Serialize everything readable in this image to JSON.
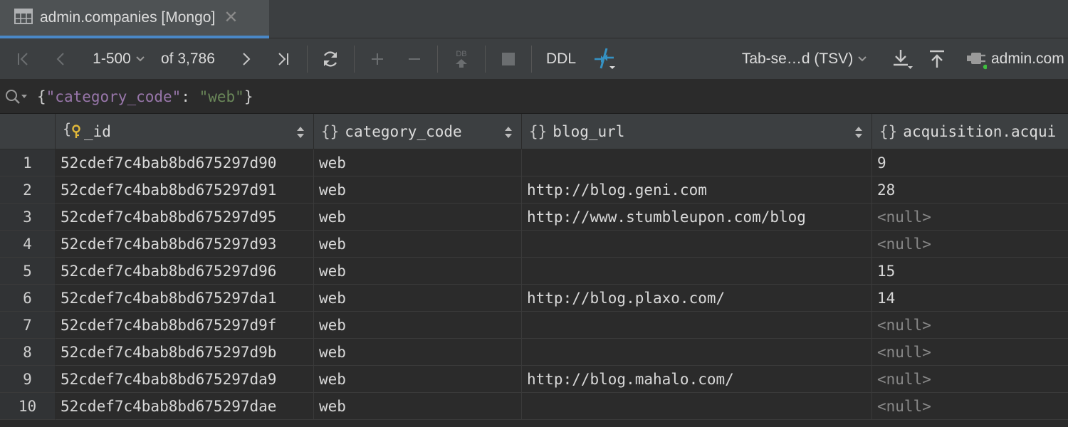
{
  "tab": {
    "title": "admin.companies [Mongo]",
    "close": "✕"
  },
  "toolbar": {
    "page_range": "1-500",
    "total": "of 3,786",
    "ddl": "DDL",
    "db_label": "DB",
    "format": "Tab-se…d (TSV)",
    "connection": "admin.com"
  },
  "filter": {
    "open": "{",
    "key": "\"category_code\"",
    "colon": ": ",
    "value": "\"web\"",
    "close": "}"
  },
  "columns": [
    {
      "name": "_id",
      "type_icon": "key-object-icon"
    },
    {
      "name": "category_code",
      "type_icon": "object-icon"
    },
    {
      "name": "blog_url",
      "type_icon": "object-icon"
    },
    {
      "name": "acquisition.acqui",
      "type_icon": "object-icon"
    }
  ],
  "rows": [
    {
      "n": "1",
      "id": "52cdef7c4bab8bd675297d90",
      "category_code": "web",
      "blog_url": "",
      "acq": "9"
    },
    {
      "n": "2",
      "id": "52cdef7c4bab8bd675297d91",
      "category_code": "web",
      "blog_url": "http://blog.geni.com",
      "acq": "28"
    },
    {
      "n": "3",
      "id": "52cdef7c4bab8bd675297d95",
      "category_code": "web",
      "blog_url": "http://www.stumbleupon.com/blog",
      "acq": "<null>"
    },
    {
      "n": "4",
      "id": "52cdef7c4bab8bd675297d93",
      "category_code": "web",
      "blog_url": "",
      "acq": "<null>"
    },
    {
      "n": "5",
      "id": "52cdef7c4bab8bd675297d96",
      "category_code": "web",
      "blog_url": "",
      "acq": "15"
    },
    {
      "n": "6",
      "id": "52cdef7c4bab8bd675297da1",
      "category_code": "web",
      "blog_url": "http://blog.plaxo.com/",
      "acq": "14"
    },
    {
      "n": "7",
      "id": "52cdef7c4bab8bd675297d9f",
      "category_code": "web",
      "blog_url": "",
      "acq": "<null>"
    },
    {
      "n": "8",
      "id": "52cdef7c4bab8bd675297d9b",
      "category_code": "web",
      "blog_url": "",
      "acq": "<null>"
    },
    {
      "n": "9",
      "id": "52cdef7c4bab8bd675297da9",
      "category_code": "web",
      "blog_url": "http://blog.mahalo.com/",
      "acq": "<null>"
    },
    {
      "n": "10",
      "id": "52cdef7c4bab8bd675297dae",
      "category_code": "web",
      "blog_url": "",
      "acq": "<null>"
    }
  ],
  "colors": {
    "background": "#2b2b2b",
    "toolbar": "#3c3f41",
    "tab_active_underline": "#4a88c7",
    "filter_key": "#9876aa",
    "filter_value": "#6a8759",
    "null_text": "#888888",
    "accent_blue": "#3592c4"
  },
  "icons": {
    "first_page": "first-page-icon",
    "prev_page": "previous-page-icon",
    "next_page": "next-page-icon",
    "last_page": "last-page-icon",
    "reload": "reload-icon",
    "add_row": "add-row-icon",
    "delete_row": "delete-row-icon",
    "submit": "submit-to-db-icon",
    "stop": "stop-icon",
    "compare": "compare-icon",
    "export": "export-icon",
    "import": "import-icon",
    "connection": "connection-icon",
    "search": "search-icon"
  }
}
